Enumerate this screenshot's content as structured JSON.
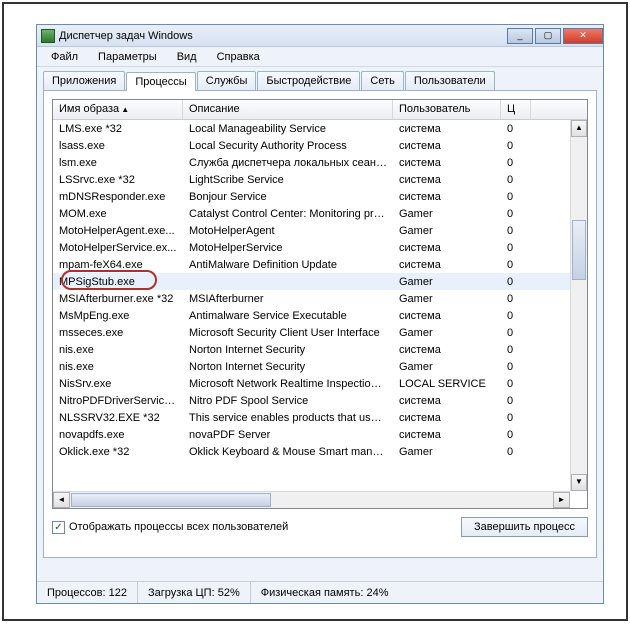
{
  "window": {
    "title": "Диспетчер задач Windows"
  },
  "menu": [
    "Файл",
    "Параметры",
    "Вид",
    "Справка"
  ],
  "tabs": [
    "Приложения",
    "Процессы",
    "Службы",
    "Быстродействие",
    "Сеть",
    "Пользователи"
  ],
  "active_tab": 1,
  "columns": [
    "Имя образа",
    "Описание",
    "Пользователь",
    "Ц"
  ],
  "rows": [
    {
      "name": "LMS.exe *32",
      "desc": "Local Manageability Service",
      "user": "система",
      "c": "0"
    },
    {
      "name": "lsass.exe",
      "desc": "Local Security Authority Process",
      "user": "система",
      "c": "0"
    },
    {
      "name": "lsm.exe",
      "desc": "Служба диспетчера локальных сеансов",
      "user": "система",
      "c": "0"
    },
    {
      "name": "LSSrvc.exe *32",
      "desc": "LightScribe Service",
      "user": "система",
      "c": "0"
    },
    {
      "name": "mDNSResponder.exe",
      "desc": "Bonjour Service",
      "user": "система",
      "c": "0"
    },
    {
      "name": "MOM.exe",
      "desc": "Catalyst Control Center: Monitoring prog...",
      "user": "Gamer",
      "c": "0"
    },
    {
      "name": "MotoHelperAgent.exe...",
      "desc": "MotoHelperAgent",
      "user": "Gamer",
      "c": "0"
    },
    {
      "name": "MotoHelperService.ex...",
      "desc": "MotoHelperService",
      "user": "система",
      "c": "0"
    },
    {
      "name": "mpam-feX64.exe",
      "desc": "AntiMalware Definition Update",
      "user": "система",
      "c": "0"
    },
    {
      "name": "MPSigStub.exe",
      "desc": "",
      "user": "Gamer",
      "c": "0",
      "sel": true,
      "hl": true
    },
    {
      "name": "MSIAfterburner.exe *32",
      "desc": "MSIAfterburner",
      "user": "Gamer",
      "c": "0"
    },
    {
      "name": "MsMpEng.exe",
      "desc": "Antimalware Service Executable",
      "user": "система",
      "c": "0"
    },
    {
      "name": "msseces.exe",
      "desc": "Microsoft Security Client User Interface",
      "user": "Gamer",
      "c": "0"
    },
    {
      "name": "nis.exe",
      "desc": "Norton Internet Security",
      "user": "система",
      "c": "0"
    },
    {
      "name": "nis.exe",
      "desc": "Norton Internet Security",
      "user": "Gamer",
      "c": "0"
    },
    {
      "name": "NisSrv.exe",
      "desc": "Microsoft Network Realtime Inspection S...",
      "user": "LOCAL SERVICE",
      "c": "0"
    },
    {
      "name": "NitroPDFDriverService...",
      "desc": "Nitro PDF Spool Service",
      "user": "система",
      "c": "0"
    },
    {
      "name": "NLSSRV32.EXE *32",
      "desc": "This service enables products that use t...",
      "user": "система",
      "c": "0"
    },
    {
      "name": "novapdfs.exe",
      "desc": "novaPDF Server",
      "user": "система",
      "c": "0"
    },
    {
      "name": "Oklick.exe *32",
      "desc": "Oklick Keyboard & Mouse Smart manager",
      "user": "Gamer",
      "c": "0"
    }
  ],
  "checkbox": {
    "checked": true,
    "label": "Отображать процессы всех пользователей"
  },
  "end_button": "Завершить процесс",
  "status": {
    "procs_label": "Процессов:",
    "procs": "122",
    "cpu_label": "Загрузка ЦП:",
    "cpu": "52%",
    "mem_label": "Физическая память:",
    "mem": "24%"
  }
}
